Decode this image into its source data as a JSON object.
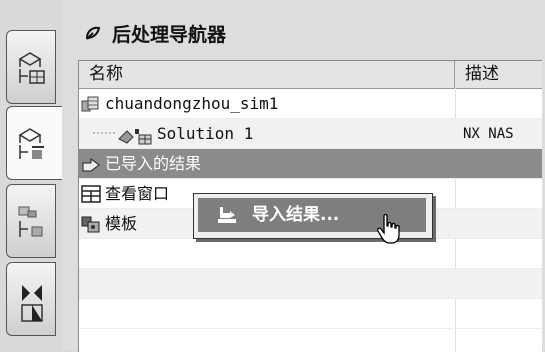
{
  "navigator": {
    "title": "后处理导航器",
    "columns": {
      "name": "名称",
      "description": "描述"
    },
    "rows": [
      {
        "name": "chuandongzhou_sim1",
        "description": ""
      },
      {
        "name": "Solution 1",
        "description": "NX NAS"
      },
      {
        "name": "已导入的结果",
        "description": ""
      },
      {
        "name": "查看窗口",
        "description": ""
      },
      {
        "name": "模板",
        "description": ""
      }
    ]
  },
  "context_menu": {
    "import_results": "导入结果..."
  },
  "sidebar": {
    "tabs": [
      "part-navigator-icon",
      "post-processing-navigator-icon",
      "assembly-navigator-icon",
      "constraint-navigator-icon"
    ]
  }
}
